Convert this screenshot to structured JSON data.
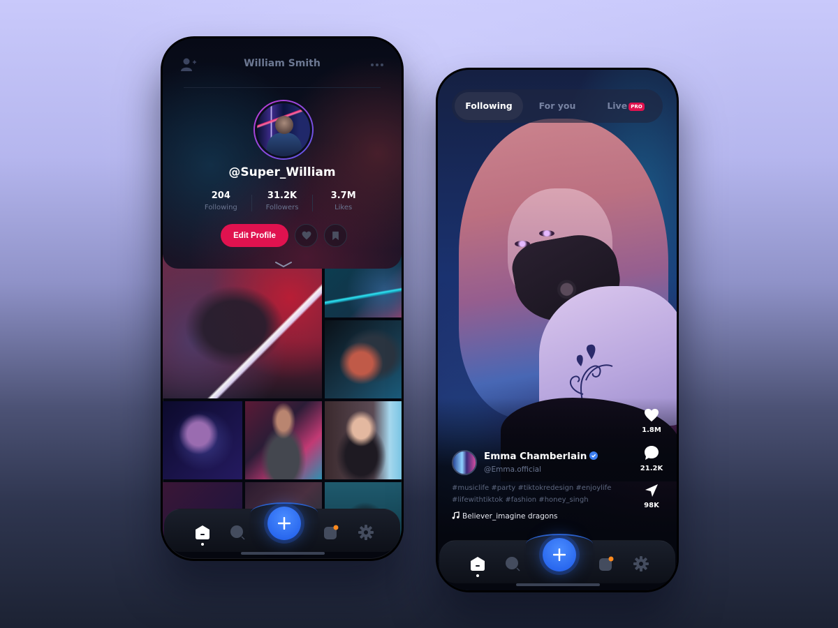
{
  "colors": {
    "accent_pink": "#e0124f",
    "accent_blue": "#2f6bf2",
    "notification_orange": "#ff8a1e",
    "verified_blue": "#3d7ef0"
  },
  "profile_screen": {
    "header": {
      "title": "William Smith",
      "add_user_icon": "add-user-icon",
      "more_icon": "more-dots-icon"
    },
    "profile": {
      "handle": "@Super_William",
      "stats": [
        {
          "value": "204",
          "label": "Following"
        },
        {
          "value": "31.2K",
          "label": "Followers"
        },
        {
          "value": "3.7M",
          "label": "Likes"
        }
      ],
      "edit_button": "Edit Profile",
      "like_icon": "heart-icon",
      "bookmark_icon": "bookmark-icon"
    },
    "grid_items": 9
  },
  "feed_screen": {
    "tabs": [
      {
        "label": "Following",
        "active": true
      },
      {
        "label": "For you",
        "active": false
      },
      {
        "label": "Live",
        "badge": "PRO",
        "active": false
      }
    ],
    "creator": {
      "name": "Emma Chamberlain",
      "verified": true,
      "handle": "@Emma.official"
    },
    "hashtags": [
      "#musiclife #party #tiktokredesign #enjoylife",
      "#lifewithtiktok #fashion #honey_singh"
    ],
    "song": "Believer_imagine dragons",
    "actions": [
      {
        "icon": "heart-icon",
        "count": "1.8M"
      },
      {
        "icon": "comment-icon",
        "count": "21.2K"
      },
      {
        "icon": "share-icon",
        "count": "98K"
      }
    ]
  },
  "bottom_nav": {
    "items": [
      {
        "icon": "home-icon",
        "active": true
      },
      {
        "icon": "search-icon",
        "active": false
      },
      {
        "icon": "plus-icon",
        "active": false
      },
      {
        "icon": "inbox-icon",
        "active": false,
        "has_notification": true
      },
      {
        "icon": "settings-icon",
        "active": false
      }
    ]
  }
}
